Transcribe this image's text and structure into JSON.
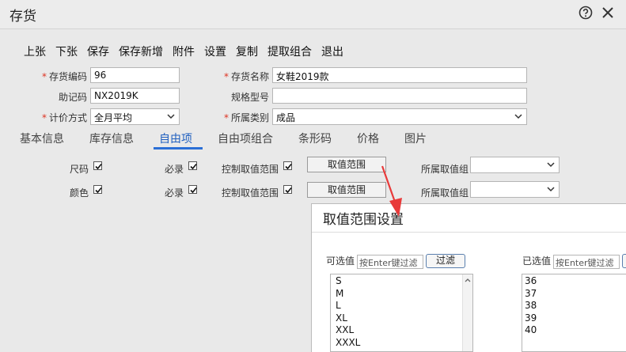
{
  "window": {
    "title": "存货"
  },
  "toolbar": [
    "上张",
    "下张",
    "保存",
    "保存新增",
    "附件",
    "设置",
    "复制",
    "提取组合",
    "退出"
  ],
  "form": {
    "code_label": "存货编码",
    "code_value": "96",
    "name_label": "存货名称",
    "name_value": "女鞋2019款",
    "mnemonic_label": "助记码",
    "mnemonic_value": "NX2019K",
    "spec_label": "规格型号",
    "spec_value": "",
    "costing_label": "计价方式",
    "costing_value": "全月平均",
    "category_label": "所属类别",
    "category_value": "成品"
  },
  "tabs": [
    "基本信息",
    "库存信息",
    "自由项",
    "自由项组合",
    "条形码",
    "价格",
    "图片"
  ],
  "active_tab": "自由项",
  "free_items": [
    {
      "name": "尺码",
      "name_checked": true,
      "required_label": "必录",
      "required_checked": true,
      "range_label": "控制取值范围",
      "range_checked": true,
      "range_button": "取值范围",
      "group_label": "所属取值组",
      "group_value": ""
    },
    {
      "name": "颜色",
      "name_checked": true,
      "required_label": "必录",
      "required_checked": true,
      "range_label": "控制取值范围",
      "range_checked": true,
      "range_button": "取值范围",
      "group_label": "所属取值组",
      "group_value": ""
    }
  ],
  "dialog": {
    "title": "取值范围设置",
    "available_label": "可选值",
    "available_placeholder": "按Enter键过滤",
    "filter_button": "过滤",
    "selected_label": "已选值",
    "selected_placeholder": "按Enter键过滤",
    "available_values": [
      "S",
      "M",
      "L",
      "XL",
      "XXL",
      "XXXL"
    ],
    "selected_values": [
      "36",
      "37",
      "38",
      "39",
      "40"
    ]
  },
  "colors": {
    "accent": "#2b6fd6",
    "required": "#dd3322",
    "annotation_arrow": "#e83a3a"
  }
}
